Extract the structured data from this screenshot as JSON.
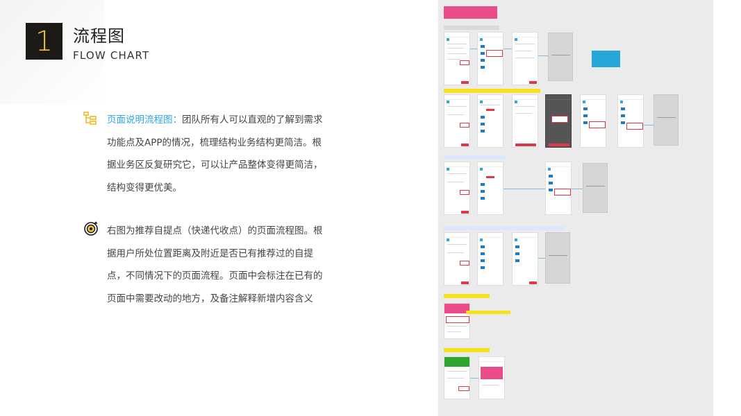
{
  "header": {
    "number": "1",
    "title_cn": "流程图",
    "title_en": "FLOW CHART"
  },
  "section1": {
    "icon": "flowchart-icon",
    "highlight": "页面说明流程图：",
    "body": "团队所有人可以直观的了解到需求功能点及APP的情况，梳理结构业务结构更简洁。根据业务区反复研究它，可以让产品整体变得更简洁，结构变得更优美。"
  },
  "section2": {
    "icon": "target-icon",
    "body": "右图为推荐自提点（快递代收点）的页面流程图。根据用户所处位置距离及附近是否已有推荐过的自提点，不同情况下的页面流程。页面中会标注在已有的页面中需要改动的地方，及备注解释新增内容含义"
  },
  "colors": {
    "accent_blue": "#2fa6e0",
    "number_box_bg": "#1c1a17",
    "number_box_fg": "#f2c232",
    "banner_pink": "#ea4c89"
  }
}
